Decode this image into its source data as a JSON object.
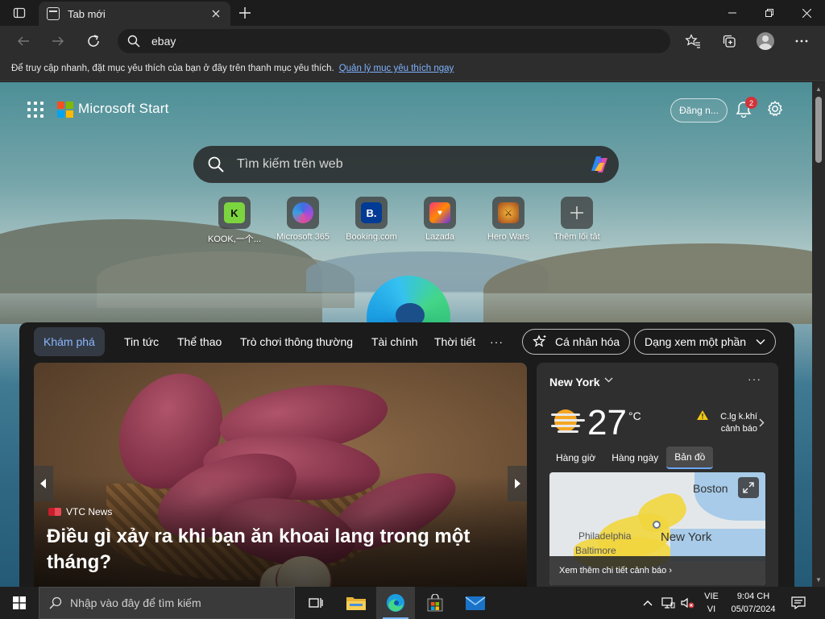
{
  "browser": {
    "tab_title": "Tab mới",
    "address_text": "ebay",
    "favbar_text": "Để truy cập nhanh, đặt mục yêu thích của bạn ở đây trên thanh mục yêu thích.",
    "favbar_link": "Quản lý mục yêu thích ngay"
  },
  "start": {
    "brand": "Microsoft Start",
    "signin_label": "Đăng n...",
    "notification_count": "2",
    "search_placeholder": "Tìm kiếm trên web",
    "quick_links": [
      {
        "label": "KOOK,一个...",
        "icon": "kook-icon"
      },
      {
        "label": "Microsoft 365",
        "icon": "microsoft-365-icon"
      },
      {
        "label": "Booking.com",
        "icon": "booking-icon"
      },
      {
        "label": "Lazada",
        "icon": "lazada-icon"
      },
      {
        "label": "Hero Wars",
        "icon": "hero-wars-icon"
      },
      {
        "label": "Thêm lối tắt",
        "icon": "plus-icon"
      }
    ]
  },
  "feed": {
    "tabs": [
      "Khám phá",
      "Tin tức",
      "Thể thao",
      "Trò chơi thông thường",
      "Tài chính",
      "Thời tiết"
    ],
    "more": "···",
    "personalize_label": "Cá nhân hóa",
    "view_label": "Dạng xem một phần",
    "hero": {
      "source": "VTC News",
      "title": "Điều gì xảy ra khi bạn ăn khoai lang trong một tháng?"
    },
    "weather": {
      "location": "New York",
      "temperature": "27",
      "unit": "°C",
      "warning": "C.lg k.khí cảnh báo",
      "tabs": [
        "Hàng giờ",
        "Hàng ngày",
        "Bản đồ"
      ],
      "map_labels": {
        "boston": "Boston",
        "new_york": "New York",
        "philadelphia": "Philadelphia",
        "baltimore": "Baltimore"
      },
      "footer": "Xem thêm chi tiết cảnh báo ›"
    }
  },
  "taskbar": {
    "search_placeholder": "Nhập vào đây để tìm kiếm",
    "lang_top": "VIE",
    "lang_bottom": "VI",
    "time": "9:04 CH",
    "date": "05/07/2024"
  },
  "colors": {
    "accent_link": "#7fb2ff",
    "badge_red": "#d13438",
    "active_tab_text": "#8ab8ff"
  }
}
